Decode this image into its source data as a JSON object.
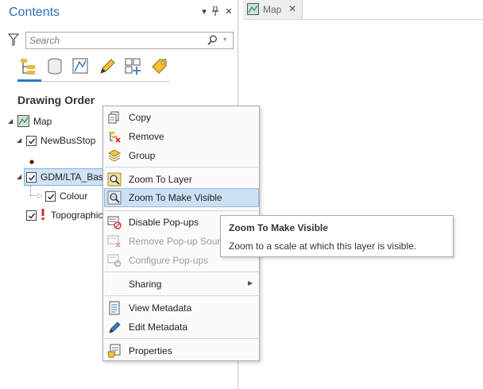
{
  "contents_pane": {
    "title": "Contents",
    "controls": {
      "dropdown": "▾",
      "pin": "📌",
      "close": "✕"
    },
    "search_placeholder": "Search",
    "view_tools": [
      "list-by-drawing-order-icon",
      "list-by-source-icon",
      "list-by-selection-icon",
      "list-by-editing-icon",
      "list-by-snapping-icon",
      "list-by-labeling-icon"
    ],
    "section_title": "Drawing Order",
    "tree": {
      "map": "Map",
      "layer1": "NewBusStop",
      "layer2": "GDM/LTA_Base",
      "layer2_child": "Colour",
      "layer3": "Topographic"
    }
  },
  "map_tab": {
    "label": "Map",
    "close": "✕"
  },
  "context_menu": {
    "items": [
      {
        "label": "Copy"
      },
      {
        "label": "Remove"
      },
      {
        "label": "Group"
      },
      {
        "label": "Zoom To Layer"
      },
      {
        "label": "Zoom To Make Visible"
      },
      {
        "label": "Disable Pop-ups"
      },
      {
        "label": "Remove Pop-up Source"
      },
      {
        "label": "Configure Pop-ups"
      },
      {
        "label": "Sharing"
      },
      {
        "label": "View Metadata"
      },
      {
        "label": "Edit Metadata"
      },
      {
        "label": "Properties"
      }
    ]
  },
  "tooltip": {
    "title": "Zoom To Make Visible",
    "body": "Zoom to a scale at which this layer is visible."
  }
}
